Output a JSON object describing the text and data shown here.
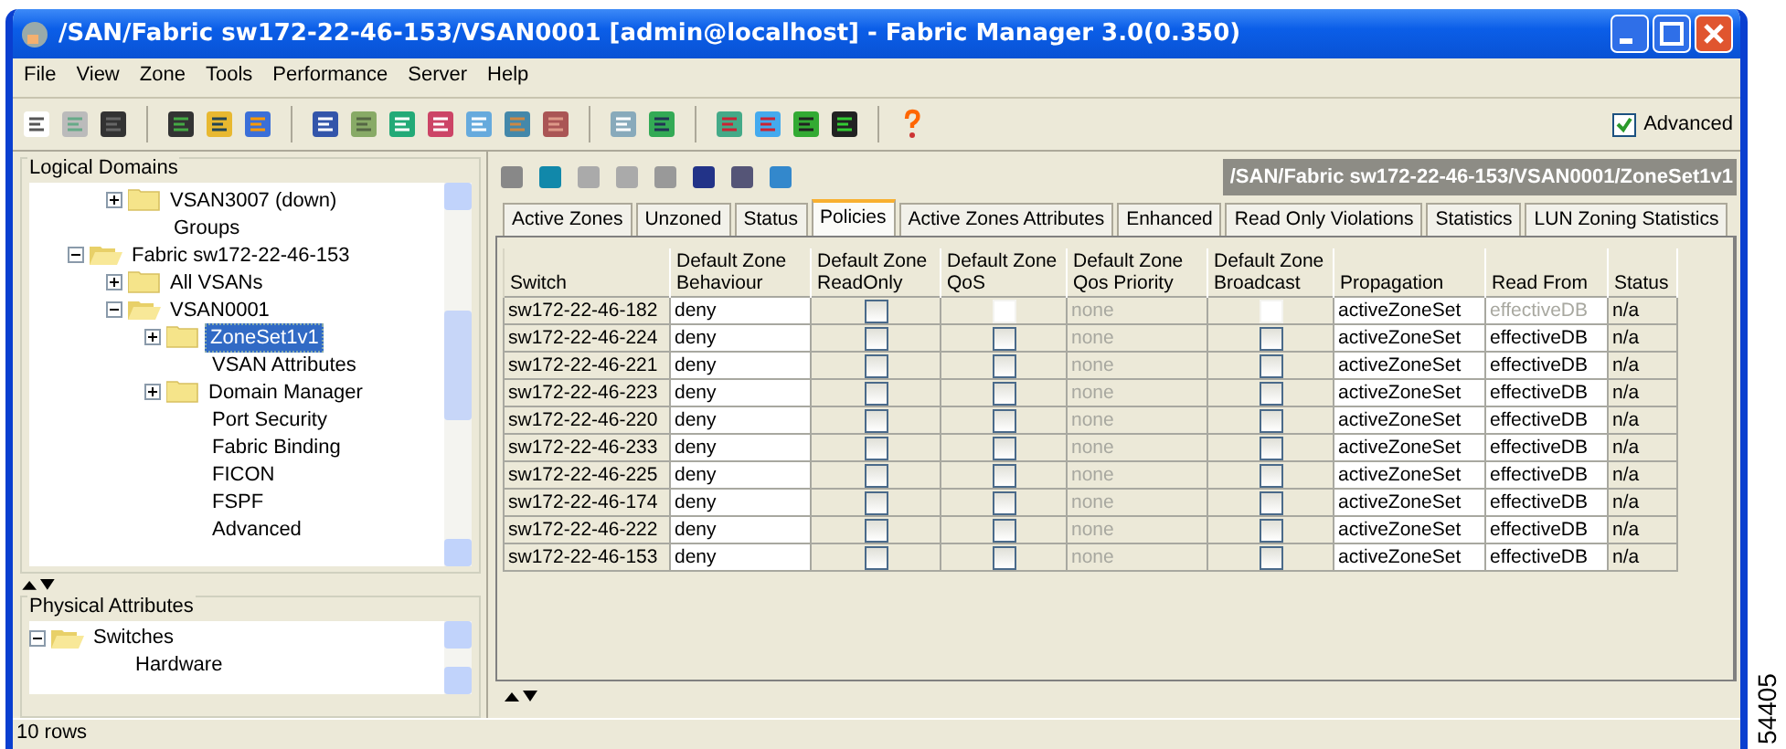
{
  "window": {
    "title": "/SAN/Fabric sw172-22-46-153/VSAN0001 [admin@localhost] - Fabric Manager 3.0(0.350)"
  },
  "menu": [
    "File",
    "View",
    "Zone",
    "Tools",
    "Performance",
    "Server",
    "Help"
  ],
  "advanced": {
    "label": "Advanced",
    "checked": true
  },
  "logical_domains": {
    "title": "Logical Domains",
    "items": [
      {
        "children": [
          {
            "label": "VSAN3007 (down)",
            "folder": true,
            "expanded": false,
            "selected": false
          },
          {
            "label": "Groups",
            "folder": false,
            "selected": false
          }
        ]
      },
      {
        "label": "Fabric sw172-22-46-153",
        "folder": true,
        "expanded": true,
        "selected": false,
        "children": [
          {
            "label": "All VSANs",
            "folder": true,
            "expanded": false,
            "selected": false
          },
          {
            "label": "VSAN0001",
            "folder": true,
            "expanded": true,
            "selected": false,
            "children": [
              {
                "label": "ZoneSet1v1",
                "folder": true,
                "expanded": false,
                "selected": true
              },
              {
                "label": "VSAN Attributes",
                "folder": false,
                "selected": false
              },
              {
                "label": "Domain Manager",
                "folder": true,
                "expanded": false,
                "selected": false
              },
              {
                "label": "Port Security",
                "folder": false,
                "selected": false
              },
              {
                "label": "Fabric Binding",
                "folder": false,
                "selected": false
              },
              {
                "label": "FICON",
                "folder": false,
                "selected": false
              },
              {
                "label": "FSPF",
                "folder": false,
                "selected": false
              },
              {
                "label": "Advanced",
                "folder": false,
                "selected": false
              }
            ]
          }
        ]
      }
    ]
  },
  "physical_attributes": {
    "title": "Physical Attributes",
    "items": [
      {
        "label": "Switches",
        "folder": true,
        "expanded": true,
        "selected": false,
        "children": [
          {
            "label": "Hardware",
            "folder": false,
            "selected": false
          }
        ]
      }
    ]
  },
  "path": "/SAN/Fabric sw172-22-46-153/VSAN0001/ZoneSet1v1",
  "tabs": [
    {
      "label": "Active Zones",
      "selected": false
    },
    {
      "label": "Unzoned",
      "selected": false
    },
    {
      "label": "Status",
      "selected": false
    },
    {
      "label": "Policies",
      "selected": true
    },
    {
      "label": "Active Zones Attributes",
      "selected": false
    },
    {
      "label": "Enhanced",
      "selected": false
    },
    {
      "label": "Read Only Violations",
      "selected": false
    },
    {
      "label": "Statistics",
      "selected": false
    },
    {
      "label": "LUN Zoning Statistics",
      "selected": false
    }
  ],
  "table": {
    "columns": [
      "Switch",
      "Default Zone Behaviour",
      "Default Zone ReadOnly",
      "Default Zone QoS",
      "Default Zone Qos Priority",
      "Default Zone Broadcast",
      "Propagation",
      "Read From",
      "Status"
    ],
    "rows": [
      {
        "cells": [
          {
            "kind": "text",
            "text": "sw172-22-46-182",
            "editable": false,
            "disabled": false
          },
          {
            "kind": "text",
            "text": "deny",
            "editable": true,
            "disabled": false
          },
          {
            "kind": "check",
            "checked": false,
            "disabled": false
          },
          {
            "kind": "check",
            "checked": false,
            "disabled": true
          },
          {
            "kind": "text",
            "text": "none",
            "editable": false,
            "disabled": true
          },
          {
            "kind": "check",
            "checked": false,
            "disabled": true
          },
          {
            "kind": "text",
            "text": "activeZoneSet",
            "editable": true,
            "disabled": false
          },
          {
            "kind": "text",
            "text": "effectiveDB",
            "editable": true,
            "disabled": true
          },
          {
            "kind": "text",
            "text": "n/a",
            "editable": false,
            "disabled": false
          }
        ]
      },
      {
        "cells": [
          {
            "kind": "text",
            "text": "sw172-22-46-224",
            "editable": false,
            "disabled": false
          },
          {
            "kind": "text",
            "text": "deny",
            "editable": true,
            "disabled": false
          },
          {
            "kind": "check",
            "checked": false,
            "disabled": false
          },
          {
            "kind": "check",
            "checked": false,
            "disabled": false
          },
          {
            "kind": "text",
            "text": "none",
            "editable": false,
            "disabled": true
          },
          {
            "kind": "check",
            "checked": false,
            "disabled": false
          },
          {
            "kind": "text",
            "text": "activeZoneSet",
            "editable": true,
            "disabled": false
          },
          {
            "kind": "text",
            "text": "effectiveDB",
            "editable": true,
            "disabled": false
          },
          {
            "kind": "text",
            "text": "n/a",
            "editable": false,
            "disabled": false
          }
        ]
      },
      {
        "cells": [
          {
            "kind": "text",
            "text": "sw172-22-46-221",
            "editable": false,
            "disabled": false
          },
          {
            "kind": "text",
            "text": "deny",
            "editable": true,
            "disabled": false
          },
          {
            "kind": "check",
            "checked": false,
            "disabled": false
          },
          {
            "kind": "check",
            "checked": false,
            "disabled": false
          },
          {
            "kind": "text",
            "text": "none",
            "editable": false,
            "disabled": true
          },
          {
            "kind": "check",
            "checked": false,
            "disabled": false
          },
          {
            "kind": "text",
            "text": "activeZoneSet",
            "editable": true,
            "disabled": false
          },
          {
            "kind": "text",
            "text": "effectiveDB",
            "editable": true,
            "disabled": false
          },
          {
            "kind": "text",
            "text": "n/a",
            "editable": false,
            "disabled": false
          }
        ]
      },
      {
        "cells": [
          {
            "kind": "text",
            "text": "sw172-22-46-223",
            "editable": false,
            "disabled": false
          },
          {
            "kind": "text",
            "text": "deny",
            "editable": true,
            "disabled": false
          },
          {
            "kind": "check",
            "checked": false,
            "disabled": false
          },
          {
            "kind": "check",
            "checked": false,
            "disabled": false
          },
          {
            "kind": "text",
            "text": "none",
            "editable": false,
            "disabled": true
          },
          {
            "kind": "check",
            "checked": false,
            "disabled": false
          },
          {
            "kind": "text",
            "text": "activeZoneSet",
            "editable": true,
            "disabled": false
          },
          {
            "kind": "text",
            "text": "effectiveDB",
            "editable": true,
            "disabled": false
          },
          {
            "kind": "text",
            "text": "n/a",
            "editable": false,
            "disabled": false
          }
        ]
      },
      {
        "cells": [
          {
            "kind": "text",
            "text": "sw172-22-46-220",
            "editable": false,
            "disabled": false
          },
          {
            "kind": "text",
            "text": "deny",
            "editable": true,
            "disabled": false
          },
          {
            "kind": "check",
            "checked": false,
            "disabled": false
          },
          {
            "kind": "check",
            "checked": false,
            "disabled": false
          },
          {
            "kind": "text",
            "text": "none",
            "editable": false,
            "disabled": true
          },
          {
            "kind": "check",
            "checked": false,
            "disabled": false
          },
          {
            "kind": "text",
            "text": "activeZoneSet",
            "editable": true,
            "disabled": false
          },
          {
            "kind": "text",
            "text": "effectiveDB",
            "editable": true,
            "disabled": false
          },
          {
            "kind": "text",
            "text": "n/a",
            "editable": false,
            "disabled": false
          }
        ]
      },
      {
        "cells": [
          {
            "kind": "text",
            "text": "sw172-22-46-233",
            "editable": false,
            "disabled": false
          },
          {
            "kind": "text",
            "text": "deny",
            "editable": true,
            "disabled": false
          },
          {
            "kind": "check",
            "checked": false,
            "disabled": false
          },
          {
            "kind": "check",
            "checked": false,
            "disabled": false
          },
          {
            "kind": "text",
            "text": "none",
            "editable": false,
            "disabled": true
          },
          {
            "kind": "check",
            "checked": false,
            "disabled": false
          },
          {
            "kind": "text",
            "text": "activeZoneSet",
            "editable": true,
            "disabled": false
          },
          {
            "kind": "text",
            "text": "effectiveDB",
            "editable": true,
            "disabled": false
          },
          {
            "kind": "text",
            "text": "n/a",
            "editable": false,
            "disabled": false
          }
        ]
      },
      {
        "cells": [
          {
            "kind": "text",
            "text": "sw172-22-46-225",
            "editable": false,
            "disabled": false
          },
          {
            "kind": "text",
            "text": "deny",
            "editable": true,
            "disabled": false
          },
          {
            "kind": "check",
            "checked": false,
            "disabled": false
          },
          {
            "kind": "check",
            "checked": false,
            "disabled": false
          },
          {
            "kind": "text",
            "text": "none",
            "editable": false,
            "disabled": true
          },
          {
            "kind": "check",
            "checked": false,
            "disabled": false
          },
          {
            "kind": "text",
            "text": "activeZoneSet",
            "editable": true,
            "disabled": false
          },
          {
            "kind": "text",
            "text": "effectiveDB",
            "editable": true,
            "disabled": false
          },
          {
            "kind": "text",
            "text": "n/a",
            "editable": false,
            "disabled": false
          }
        ]
      },
      {
        "cells": [
          {
            "kind": "text",
            "text": "sw172-22-46-174",
            "editable": false,
            "disabled": false
          },
          {
            "kind": "text",
            "text": "deny",
            "editable": true,
            "disabled": false
          },
          {
            "kind": "check",
            "checked": false,
            "disabled": false
          },
          {
            "kind": "check",
            "checked": false,
            "disabled": false
          },
          {
            "kind": "text",
            "text": "none",
            "editable": false,
            "disabled": true
          },
          {
            "kind": "check",
            "checked": false,
            "disabled": false
          },
          {
            "kind": "text",
            "text": "activeZoneSet",
            "editable": true,
            "disabled": false
          },
          {
            "kind": "text",
            "text": "effectiveDB",
            "editable": true,
            "disabled": false
          },
          {
            "kind": "text",
            "text": "n/a",
            "editable": false,
            "disabled": false
          }
        ]
      },
      {
        "cells": [
          {
            "kind": "text",
            "text": "sw172-22-46-222",
            "editable": false,
            "disabled": false
          },
          {
            "kind": "text",
            "text": "deny",
            "editable": true,
            "disabled": false
          },
          {
            "kind": "check",
            "checked": false,
            "disabled": false
          },
          {
            "kind": "check",
            "checked": false,
            "disabled": false
          },
          {
            "kind": "text",
            "text": "none",
            "editable": false,
            "disabled": true
          },
          {
            "kind": "check",
            "checked": false,
            "disabled": false
          },
          {
            "kind": "text",
            "text": "activeZoneSet",
            "editable": true,
            "disabled": false
          },
          {
            "kind": "text",
            "text": "effectiveDB",
            "editable": true,
            "disabled": false
          },
          {
            "kind": "text",
            "text": "n/a",
            "editable": false,
            "disabled": false
          }
        ]
      },
      {
        "cells": [
          {
            "kind": "text",
            "text": "sw172-22-46-153",
            "editable": false,
            "disabled": false
          },
          {
            "kind": "text",
            "text": "deny",
            "editable": true,
            "disabled": false
          },
          {
            "kind": "check",
            "checked": false,
            "disabled": false
          },
          {
            "kind": "check",
            "checked": false,
            "disabled": false
          },
          {
            "kind": "text",
            "text": "none",
            "editable": false,
            "disabled": true
          },
          {
            "kind": "check",
            "checked": false,
            "disabled": false
          },
          {
            "kind": "text",
            "text": "activeZoneSet",
            "editable": true,
            "disabled": false
          },
          {
            "kind": "text",
            "text": "effectiveDB",
            "editable": true,
            "disabled": false
          },
          {
            "kind": "text",
            "text": "n/a",
            "editable": false,
            "disabled": false
          }
        ]
      }
    ]
  },
  "status_bar": "10 rows",
  "figure_number": "54405"
}
